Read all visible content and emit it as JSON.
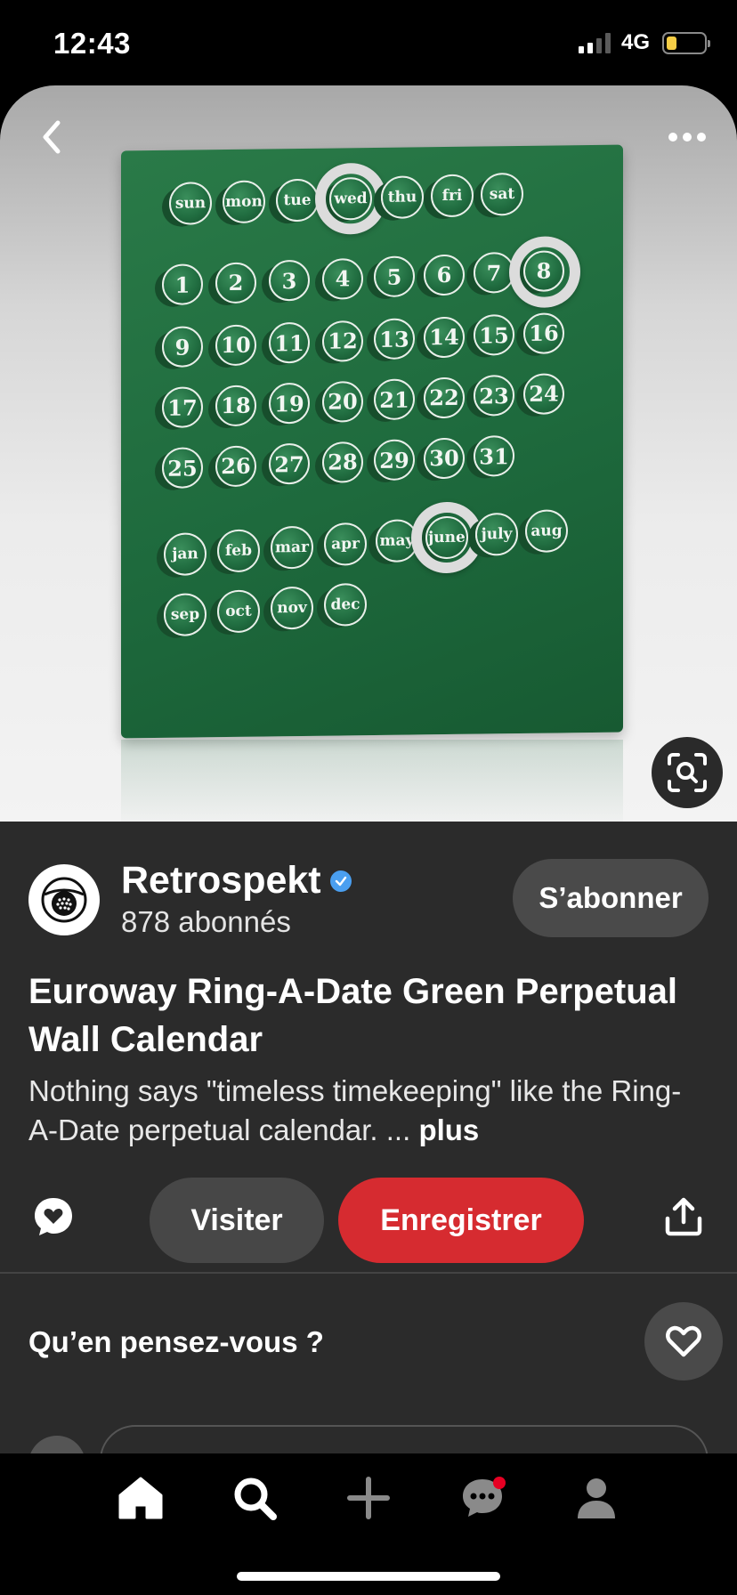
{
  "status_bar": {
    "time": "12:43",
    "network": "4G",
    "battery_color": "#f7ce46"
  },
  "hero": {
    "days": [
      "sun",
      "mon",
      "tue",
      "wed",
      "thu",
      "fri",
      "sat"
    ],
    "numbers": [
      "1",
      "2",
      "3",
      "4",
      "5",
      "6",
      "7",
      "8",
      "9",
      "10",
      "11",
      "12",
      "13",
      "14",
      "15",
      "16",
      "17",
      "18",
      "19",
      "20",
      "21",
      "22",
      "23",
      "24",
      "25",
      "26",
      "27",
      "28",
      "29",
      "30",
      "31"
    ],
    "months": [
      "jan",
      "feb",
      "mar",
      "apr",
      "may",
      "june",
      "july",
      "aug",
      "sep",
      "oct",
      "nov",
      "dec"
    ],
    "ringed": [
      "wed",
      "8",
      "june"
    ],
    "icons": {
      "back": "chevron-left-icon",
      "more": "more-dots-icon",
      "lens": "visual-search-icon"
    }
  },
  "creator": {
    "name": "Retrospekt",
    "followers": "878 abonnés",
    "verified": true,
    "follow_label": "S’abonner"
  },
  "pin": {
    "title": "Euroway Ring-A-Date Green Perpetual Wall Calendar",
    "description": "Nothing says \"timeless timekeeping\" like the Ring-A-Date perpetual calendar. ... ",
    "more_label": "plus"
  },
  "actions": {
    "visit_label": "Visiter",
    "save_label": "Enregistrer",
    "save_color": "#d62b30"
  },
  "feedback": {
    "question": "Qu’en pensez-vous ?"
  },
  "tabbar": {
    "items": [
      "home-icon",
      "search-icon",
      "create-icon",
      "messages-icon",
      "profile-icon"
    ],
    "notification_color": "#e60023"
  }
}
